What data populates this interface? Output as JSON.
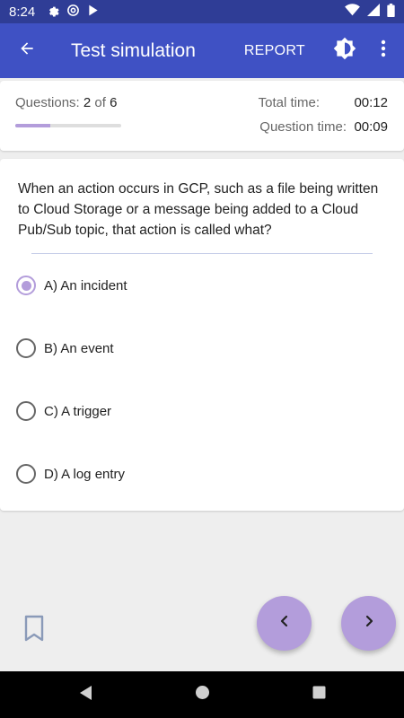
{
  "status_bar": {
    "time": "8:24",
    "left_icons": [
      "gear-icon",
      "at-sign-icon",
      "play-store-icon"
    ],
    "right_icons": [
      "wifi-icon",
      "signal-icon",
      "battery-icon"
    ]
  },
  "app_bar": {
    "title": "Test simulation",
    "report_label": "REPORT",
    "color": "#3f51c4"
  },
  "progress": {
    "questions_label": "Questions:",
    "current": "2",
    "of_label": "of",
    "total": "6",
    "fraction": 0.333,
    "total_time_label": "Total time:",
    "total_time": "00:12",
    "question_time_label": "Question time:",
    "question_time": "00:09"
  },
  "question": {
    "text": "When an action occurs in GCP, such as a file being written to Cloud Storage or a message being added to a Cloud Pub/Sub topic, that action is called what?",
    "options": [
      {
        "label": "A) An incident",
        "selected": true
      },
      {
        "label": "B) An event",
        "selected": false
      },
      {
        "label": "C) A trigger",
        "selected": false
      },
      {
        "label": "D) A log entry",
        "selected": false
      }
    ]
  },
  "accent_color": "#b39ddb"
}
